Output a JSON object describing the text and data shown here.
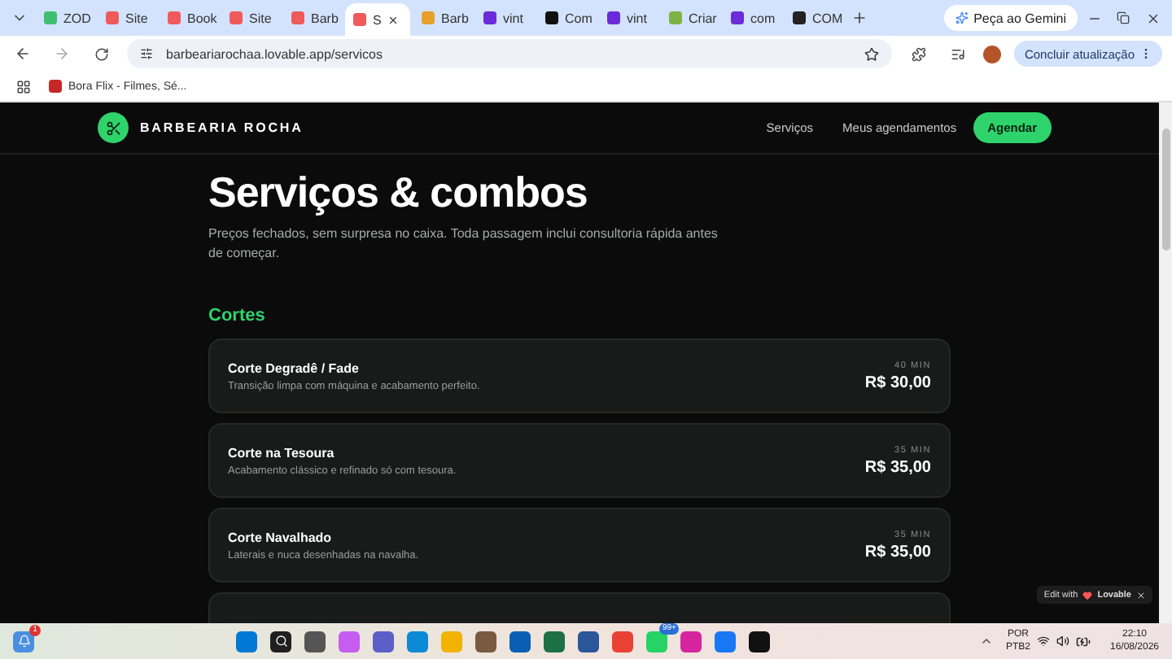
{
  "browser": {
    "tabs": [
      {
        "title": "ZOD",
        "selected": false,
        "color": "#3fbf6f"
      },
      {
        "title": "Site",
        "selected": false,
        "color": "#ef5a5a"
      },
      {
        "title": "Book",
        "selected": false,
        "color": "#ef5a5a"
      },
      {
        "title": "Site",
        "selected": false,
        "color": "#ef5a5a"
      },
      {
        "title": "Barb",
        "selected": false,
        "color": "#ef5a5a"
      },
      {
        "title": "S",
        "selected": true,
        "color": "#ef5a5a"
      },
      {
        "title": "Barb",
        "selected": false,
        "color": "#e8a02a"
      },
      {
        "title": "vint",
        "selected": false,
        "color": "#6a2bd9"
      },
      {
        "title": "Com",
        "selected": false,
        "color": "#111111"
      },
      {
        "title": "vint",
        "selected": false,
        "color": "#6a2bd9"
      },
      {
        "title": "Criar",
        "selected": false,
        "color": "#7cb342"
      },
      {
        "title": "com",
        "selected": false,
        "color": "#6a2bd9"
      },
      {
        "title": "COM",
        "selected": false,
        "color": "#222222"
      }
    ],
    "gemini_button": "Peça ao Gemini",
    "url": "barbeariarochaa.lovable.app/servicos",
    "update_button": "Concluir atualização",
    "bookmarks": [
      "Bora Flix - Filmes, Sé..."
    ]
  },
  "site": {
    "brand": "BARBEARIA ROCHA",
    "nav": [
      "Serviços",
      "Meus agendamentos"
    ],
    "cta": "Agendar",
    "title": "Serviços & combos",
    "subtitle": "Preços fechados, sem surpresa no caixa. Toda passagem inclui consultoria rápida antes de começar.",
    "section": "Cortes",
    "services": [
      {
        "name": "Corte Degradê / Fade",
        "description": "Transição limpa com máquina e acabamento perfeito.",
        "duration": "40 MIN",
        "price": "R$ 30,00"
      },
      {
        "name": "Corte na Tesoura",
        "description": "Acabamento clássico e refinado só com tesoura.",
        "duration": "35 MIN",
        "price": "R$ 35,00"
      },
      {
        "name": "Corte Navalhado",
        "description": "Laterais e nuca desenhadas na navalha.",
        "duration": "35 MIN",
        "price": "R$ 35,00"
      }
    ],
    "edit_badge": {
      "prefix": "Edit with",
      "brand": "Lovable"
    }
  },
  "taskbar": {
    "notification_count": "1",
    "whatsapp_count": "99+",
    "language": "POR",
    "layout": "PTB2",
    "time": "22:10",
    "date": "16/08/2026"
  }
}
